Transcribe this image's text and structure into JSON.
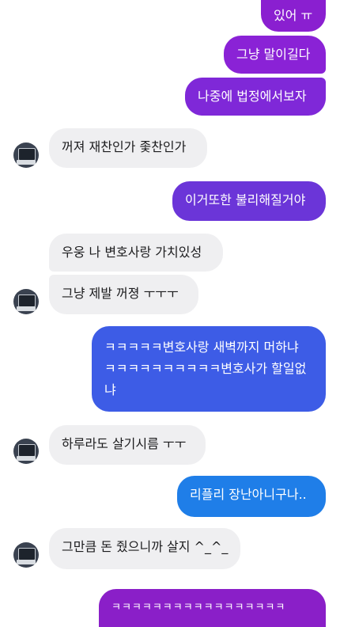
{
  "messages": [
    {
      "text": "있어 ㅠ",
      "side": "sent",
      "color": "#8a1fd0"
    },
    {
      "text": "그냥 말이길다",
      "side": "sent",
      "color": "#8a22d6"
    },
    {
      "text": "나중에 법정에서보자",
      "side": "sent",
      "color": "#7f28d8"
    },
    {
      "text": "꺼져 재찬인가 좇찬인가",
      "side": "received"
    },
    {
      "text": "이거또한 불리해질거야",
      "side": "sent",
      "color": "#6b35d8"
    },
    {
      "text": "우웅 나 변호사랑 가치있성",
      "side": "received"
    },
    {
      "text": "그냥 제발 꺼졍 ㅜㅜㅜ",
      "side": "received"
    },
    {
      "text": "ㅋㅋㅋㅋㅋ변호사랑 새벽까지 머하냐 ㅋㅋㅋㅋㅋㅋㅋㅋㅋㅋ변호사가 할일없냐",
      "side": "sent",
      "color": "#3d5ce6"
    },
    {
      "text": "하루라도 살기시름 ㅜㅜ",
      "side": "received"
    },
    {
      "text": "리플리 장난아니구나..",
      "side": "sent",
      "color": "#1f7ee8"
    },
    {
      "text": "그만큼 돈 줬으니까 살지 ^_^_",
      "side": "received"
    },
    {
      "text": "ㅋㅋㅋㅋㅋㅋㅋㅋㅋㅋㅋㅋㅋㅋㅋㅋㅋ",
      "side": "sent",
      "color": "#8a1fc8"
    }
  ],
  "avatar_icon": "monitor-avatar-icon"
}
